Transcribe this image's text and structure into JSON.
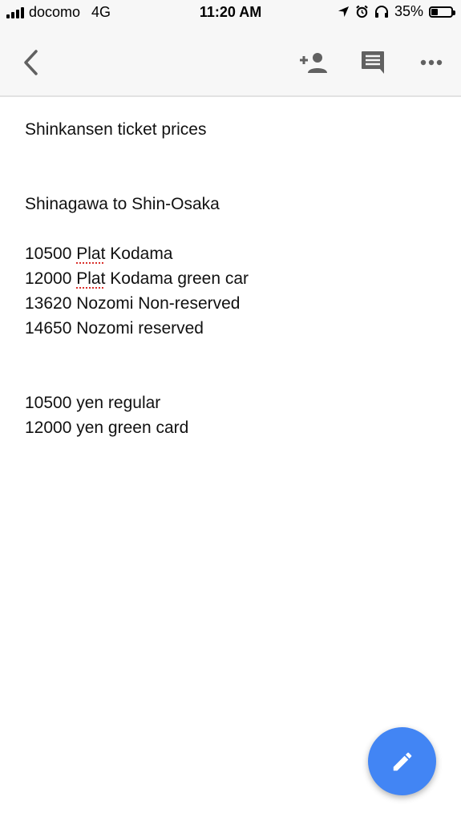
{
  "status_bar": {
    "carrier": "docomo",
    "network": "4G",
    "time": "11:20 AM",
    "battery_percent": "35%",
    "battery_level": 0.35,
    "icons": [
      "signal-icon",
      "location-arrow-icon",
      "alarm-icon",
      "headphones-icon",
      "battery-icon"
    ]
  },
  "toolbar": {
    "icons": [
      "back-chevron-icon",
      "add-person-icon",
      "comment-icon",
      "more-horizontal-icon"
    ]
  },
  "note": {
    "title": "Shinkansen ticket prices",
    "route": "Shinagawa to Shin-Osaka",
    "prices": [
      {
        "amount": "10500",
        "spell_word": "Plat",
        "rest": " Kodama"
      },
      {
        "amount": "12000",
        "spell_word": "Plat",
        "rest": " Kodama green car"
      },
      {
        "amount": "13620",
        "spell_word": "",
        "rest": "Nozomi Non-reserved"
      },
      {
        "amount": "14650",
        "spell_word": "",
        "rest": "Nozomi reserved"
      }
    ],
    "summary": [
      "10500 yen regular",
      "12000 yen green card"
    ]
  },
  "fab": {
    "icon": "pencil-edit-icon",
    "accent": "#4285f4"
  }
}
